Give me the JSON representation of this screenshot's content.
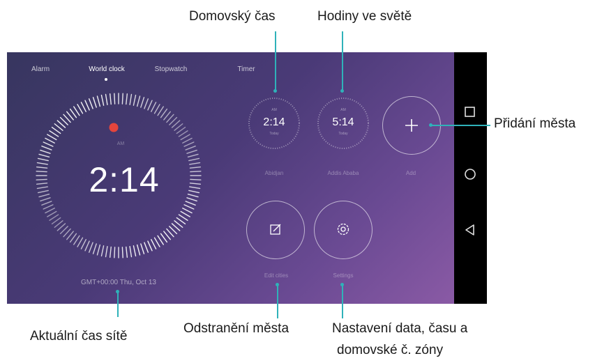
{
  "tabs": [
    {
      "label": "Alarm"
    },
    {
      "label": "World clock"
    },
    {
      "label": "Stopwatch"
    },
    {
      "label": "Timer"
    }
  ],
  "main_clock": {
    "time": "2:14",
    "date_line": "GMT+00:00  Thu, Oct 13"
  },
  "world_clocks": [
    {
      "time": "2:14",
      "day": "Today",
      "city": "Abidjan"
    },
    {
      "time": "5:14",
      "day": "Today",
      "city": "Addis Ababa"
    }
  ],
  "add_button": {
    "label": "Add",
    "icon": "plus-icon"
  },
  "edit_button": {
    "label": "Edit cities",
    "icon": "edit-icon"
  },
  "settings_button": {
    "label": "Settings",
    "icon": "gear-icon"
  },
  "nav_bar": {
    "icons": [
      "square-icon",
      "circle-icon",
      "back-triangle-icon"
    ]
  },
  "callouts": {
    "home_time": "Domovský čas",
    "world_time": "Hodiny ve světě",
    "add_city": "Přidání města",
    "network_time": "Aktuální čas sítě",
    "remove_city": "Odstranění města",
    "settings_line1": "Nastavení data, času a",
    "settings_line2": "domovské č. zóny"
  },
  "colors": {
    "callout_line": "#2fb2b9",
    "accent_dot": "#e5453c"
  }
}
